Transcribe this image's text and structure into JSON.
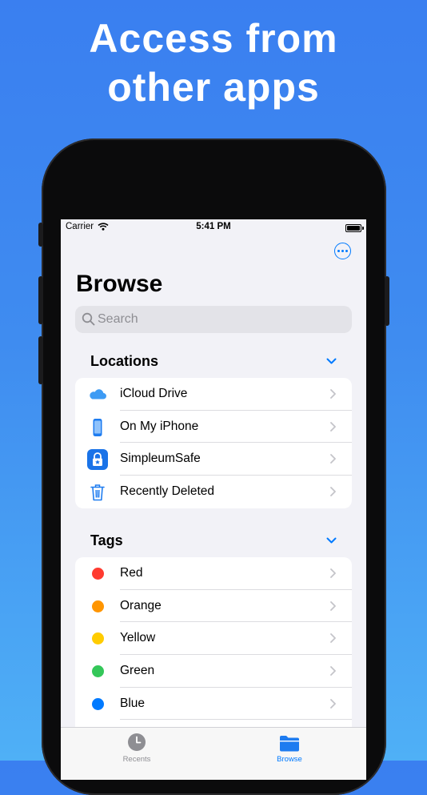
{
  "headline": {
    "line1": "Access from",
    "line2": "other apps"
  },
  "status_bar": {
    "carrier": "Carrier",
    "time": "5:41 PM"
  },
  "page": {
    "title": "Browse"
  },
  "search": {
    "placeholder": "Search"
  },
  "locations": {
    "title": "Locations",
    "items": [
      {
        "label": "iCloud Drive",
        "icon": "icloud-icon"
      },
      {
        "label": "On My iPhone",
        "icon": "iphone-icon"
      },
      {
        "label": "SimpleumSafe",
        "icon": "simpleumsafe-app-icon"
      },
      {
        "label": "Recently Deleted",
        "icon": "trash-icon"
      }
    ]
  },
  "tags": {
    "title": "Tags",
    "items": [
      {
        "label": "Red",
        "color": "#ff3b30"
      },
      {
        "label": "Orange",
        "color": "#ff9500"
      },
      {
        "label": "Yellow",
        "color": "#ffcc00"
      },
      {
        "label": "Green",
        "color": "#34c759"
      },
      {
        "label": "Blue",
        "color": "#007aff"
      }
    ]
  },
  "tab_bar": {
    "tabs": [
      {
        "label": "Recents",
        "icon": "clock-icon",
        "active": false
      },
      {
        "label": "Browse",
        "icon": "folder-icon",
        "active": true
      }
    ]
  },
  "colors": {
    "accent": "#007aff",
    "background": "#3f8cf0",
    "inactive_tab": "#8e8e93"
  }
}
